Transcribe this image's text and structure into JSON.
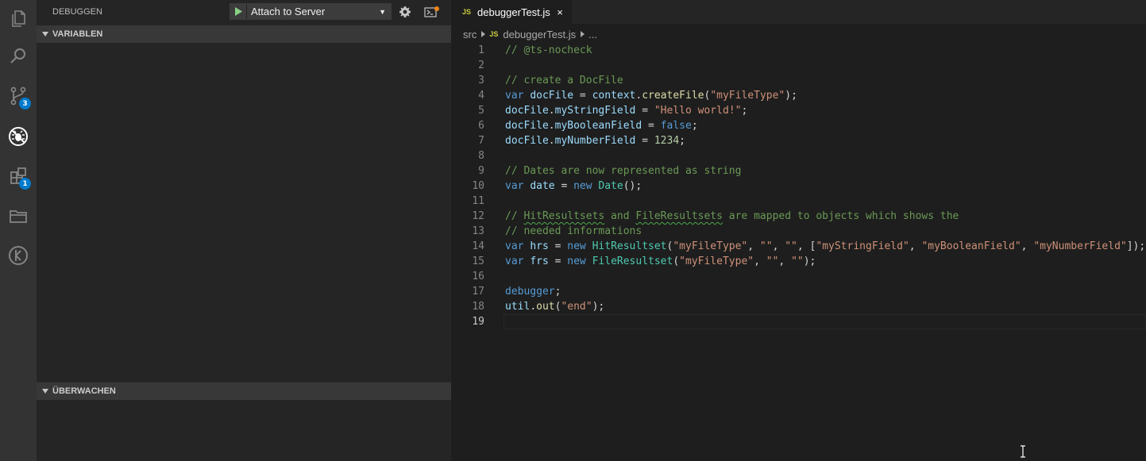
{
  "activity_bar": {
    "icons": [
      "explorer-icon",
      "search-icon",
      "source-control-icon",
      "debug-icon",
      "extensions-icon",
      "folder-icon",
      "timeline-icon"
    ],
    "scm_badge": "3",
    "extensions_badge": "1"
  },
  "sidebar": {
    "title": "DEBUGGEN",
    "config": "Attach to Server",
    "sections": {
      "variables": "VARIABLEN",
      "watch": "ÜBERWACHEN"
    }
  },
  "editor": {
    "tab": {
      "badge": "JS",
      "name": "debuggerTest.js",
      "close": "×"
    },
    "breadcrumb": {
      "folder": "src",
      "badge": "JS",
      "file": "debuggerTest.js",
      "more": "..."
    },
    "active_line": 19,
    "lines": [
      {
        "n": "1",
        "tokens": [
          [
            "cm",
            "// @ts-nocheck"
          ]
        ]
      },
      {
        "n": "2",
        "tokens": []
      },
      {
        "n": "3",
        "tokens": [
          [
            "cm",
            "// create a DocFile"
          ]
        ]
      },
      {
        "n": "4",
        "tokens": [
          [
            "kw",
            "var"
          ],
          [
            "",
            " "
          ],
          [
            "var",
            "docFile"
          ],
          [
            "",
            " = "
          ],
          [
            "var",
            "context"
          ],
          [
            "",
            "."
          ],
          [
            "fn",
            "createFile"
          ],
          [
            "",
            "("
          ],
          [
            "str",
            "\"myFileType\""
          ],
          [
            "",
            ");"
          ]
        ]
      },
      {
        "n": "5",
        "tokens": [
          [
            "var",
            "docFile"
          ],
          [
            "",
            "."
          ],
          [
            "var",
            "myStringField"
          ],
          [
            "",
            " = "
          ],
          [
            "str",
            "\"Hello world!\""
          ],
          [
            "",
            ";"
          ]
        ]
      },
      {
        "n": "6",
        "tokens": [
          [
            "var",
            "docFile"
          ],
          [
            "",
            "."
          ],
          [
            "var",
            "myBooleanField"
          ],
          [
            "",
            " = "
          ],
          [
            "kw",
            "false"
          ],
          [
            "",
            ";"
          ]
        ]
      },
      {
        "n": "7",
        "tokens": [
          [
            "var",
            "docFile"
          ],
          [
            "",
            "."
          ],
          [
            "var",
            "myNumberField"
          ],
          [
            "",
            " = "
          ],
          [
            "num",
            "1234"
          ],
          [
            "",
            ";"
          ]
        ]
      },
      {
        "n": "8",
        "tokens": []
      },
      {
        "n": "9",
        "tokens": [
          [
            "cm",
            "// Dates are now represented as string"
          ]
        ]
      },
      {
        "n": "10",
        "tokens": [
          [
            "kw",
            "var"
          ],
          [
            "",
            " "
          ],
          [
            "var",
            "date"
          ],
          [
            "",
            " = "
          ],
          [
            "kw",
            "new"
          ],
          [
            "",
            " "
          ],
          [
            "cls",
            "Date"
          ],
          [
            "",
            "();"
          ]
        ]
      },
      {
        "n": "11",
        "tokens": []
      },
      {
        "n": "12",
        "tokens": [
          [
            "cm",
            "// "
          ],
          [
            "cmsq",
            "HitResultsets"
          ],
          [
            "cm",
            " and "
          ],
          [
            "cmsq",
            "FileResultsets"
          ],
          [
            "cm",
            " are mapped to objects which shows the"
          ]
        ]
      },
      {
        "n": "13",
        "tokens": [
          [
            "cm",
            "// needed informations"
          ]
        ]
      },
      {
        "n": "14",
        "tokens": [
          [
            "kw",
            "var"
          ],
          [
            "",
            " "
          ],
          [
            "var",
            "hrs"
          ],
          [
            "",
            " = "
          ],
          [
            "kw",
            "new"
          ],
          [
            "",
            " "
          ],
          [
            "cls",
            "HitResultset"
          ],
          [
            "",
            "("
          ],
          [
            "str",
            "\"myFileType\""
          ],
          [
            "",
            ", "
          ],
          [
            "str",
            "\"\""
          ],
          [
            "",
            ", "
          ],
          [
            "str",
            "\"\""
          ],
          [
            "",
            ", ["
          ],
          [
            "str",
            "\"myStringField\""
          ],
          [
            "",
            ", "
          ],
          [
            "str",
            "\"myBooleanField\""
          ],
          [
            "",
            ", "
          ],
          [
            "str",
            "\"myNumberField\""
          ],
          [
            "",
            "]);"
          ]
        ]
      },
      {
        "n": "15",
        "tokens": [
          [
            "kw",
            "var"
          ],
          [
            "",
            " "
          ],
          [
            "var",
            "frs"
          ],
          [
            "",
            " = "
          ],
          [
            "kw",
            "new"
          ],
          [
            "",
            " "
          ],
          [
            "cls",
            "FileResultset"
          ],
          [
            "",
            "("
          ],
          [
            "str",
            "\"myFileType\""
          ],
          [
            "",
            ", "
          ],
          [
            "str",
            "\"\""
          ],
          [
            "",
            ", "
          ],
          [
            "str",
            "\"\""
          ],
          [
            "",
            ");"
          ]
        ]
      },
      {
        "n": "16",
        "tokens": []
      },
      {
        "n": "17",
        "tokens": [
          [
            "kw",
            "debugger"
          ],
          [
            "",
            ";"
          ]
        ]
      },
      {
        "n": "18",
        "tokens": [
          [
            "var",
            "util"
          ],
          [
            "",
            "."
          ],
          [
            "fn",
            "out"
          ],
          [
            "",
            "("
          ],
          [
            "str",
            "\"end\""
          ],
          [
            "",
            ");"
          ]
        ]
      },
      {
        "n": "19",
        "tokens": []
      }
    ]
  }
}
